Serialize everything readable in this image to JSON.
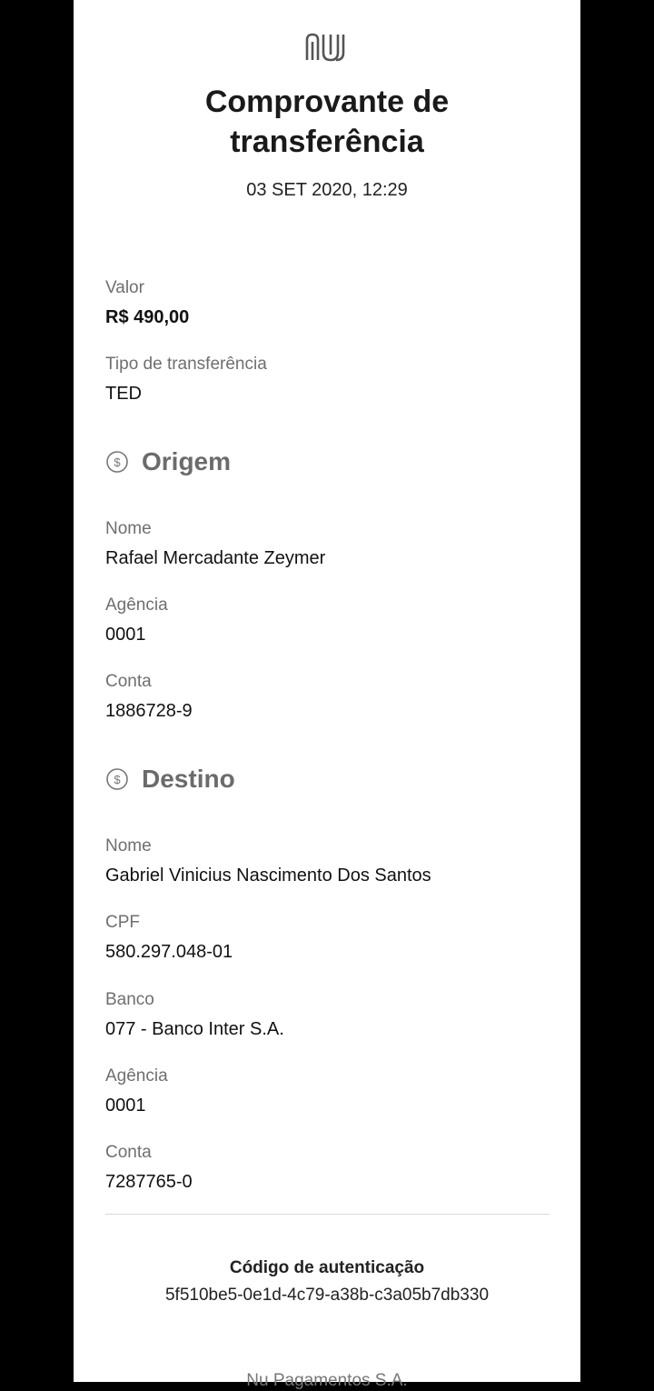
{
  "brand": {
    "logo": "nubank-logo"
  },
  "header": {
    "title_line1": "Comprovante de",
    "title_line2": "transferência",
    "date": "03 SET 2020, 12:29"
  },
  "summary": {
    "valor_label": "Valor",
    "valor": "R$ 490,00",
    "tipo_label": "Tipo de transferência",
    "tipo": "TED"
  },
  "origem": {
    "title": "Origem",
    "icon": "money-icon",
    "nome_label": "Nome",
    "nome": "Rafael Mercadante Zeymer",
    "agencia_label": "Agência",
    "agencia": "0001",
    "conta_label": "Conta",
    "conta": "1886728-9"
  },
  "destino": {
    "title": "Destino",
    "icon": "money-icon",
    "nome_label": "Nome",
    "nome": "Gabriel Vinicius Nascimento Dos Santos",
    "cpf_label": "CPF",
    "cpf": "580.297.048-01",
    "banco_label": "Banco",
    "banco": "077 - Banco Inter S.A.",
    "agencia_label": "Agência",
    "agencia": "0001",
    "conta_label": "Conta",
    "conta": "7287765-0"
  },
  "auth": {
    "label": "Código de autenticação",
    "code": "5f510be5-0e1d-4c79-a38b-c3a05b7db330"
  },
  "footer": {
    "company": "Nu Pagamentos S.A."
  },
  "colors": {
    "background": "#000000",
    "sheet": "#ffffff",
    "section_title": "#6b6b6b",
    "label": "#6f6f6f"
  }
}
